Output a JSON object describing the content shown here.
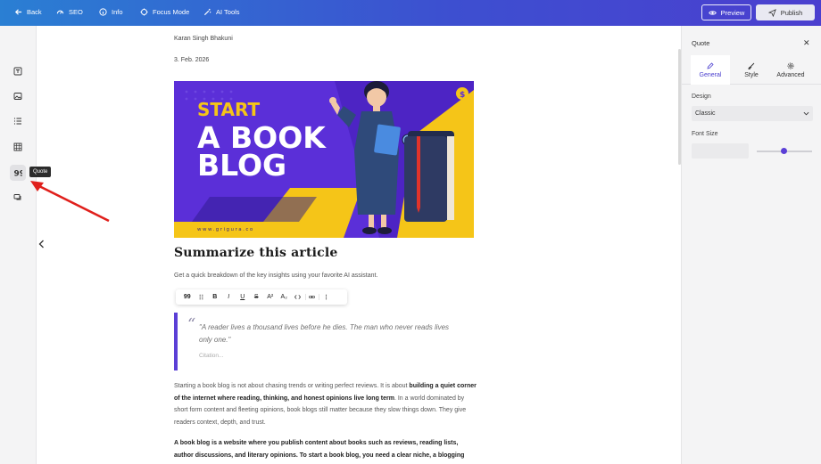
{
  "topbar": {
    "back_label": "Back",
    "seo_label": "SEO",
    "info_label": "Info",
    "focus_label": "Focus Mode",
    "ai_label": "AI Tools",
    "preview_label": "Preview",
    "publish_label": "Publish"
  },
  "sidebar": {
    "tooltip": "Quote",
    "icons": [
      "text-block-icon",
      "image-icon",
      "list-icon",
      "table-icon",
      "quote-icon",
      "comments-icon"
    ]
  },
  "article": {
    "author": "Karan Singh Bhakuni",
    "date": "3. Feb. 2026",
    "hero": {
      "line1": "START",
      "line2": "A BOOK",
      "line3": "BLOG",
      "url": "www.grigura.co"
    },
    "heading": "Summarize this article",
    "subtext": "Get a quick breakdown of the key insights using your favorite AI assistant.",
    "quote": {
      "mark": "“",
      "text": "\"A reader lives a thousand lives before he dies. The man who never reads lives only one.\"",
      "citation": "Citation..."
    },
    "para1": {
      "part1": "Starting a book blog is not about chasing trends or writing perfect reviews. It is about ",
      "bold": "building a quiet corner of the internet where reading, thinking, and honest opinions live long term",
      "part2": ". In a world dominated by short form content and fleeting opinions, book blogs still matter because they slow things down. They give readers context, depth, and trust."
    },
    "para2": {
      "bold": "A book blog is a website where you publish content about books such as reviews, reading lists, author discussions, and literary opinions. To start a book blog, you need a clear niche, a blogging"
    }
  },
  "format_toolbar": {
    "items": [
      "quote-icon",
      "drag-handle-icon",
      "B",
      "I",
      "U",
      "S",
      "A²",
      "A₂",
      "code-icon",
      "link-icon",
      "more-icon"
    ]
  },
  "panel": {
    "title": "Quote",
    "tabs": [
      {
        "label": "General",
        "icon": "pencil-icon",
        "active": true
      },
      {
        "label": "Style",
        "icon": "brush-icon",
        "active": false
      },
      {
        "label": "Advanced",
        "icon": "gear-icon",
        "active": false
      }
    ],
    "design_label": "Design",
    "design_value": "Classic",
    "font_size_label": "Font Size",
    "font_size_slider": 0.5
  },
  "colors": {
    "accent": "#5b3fd6",
    "topbar_start": "#2a7fd3",
    "topbar_end": "#4b3fcf",
    "hero_bg": "#5b2fd8",
    "hero_yellow": "#f5c518"
  }
}
